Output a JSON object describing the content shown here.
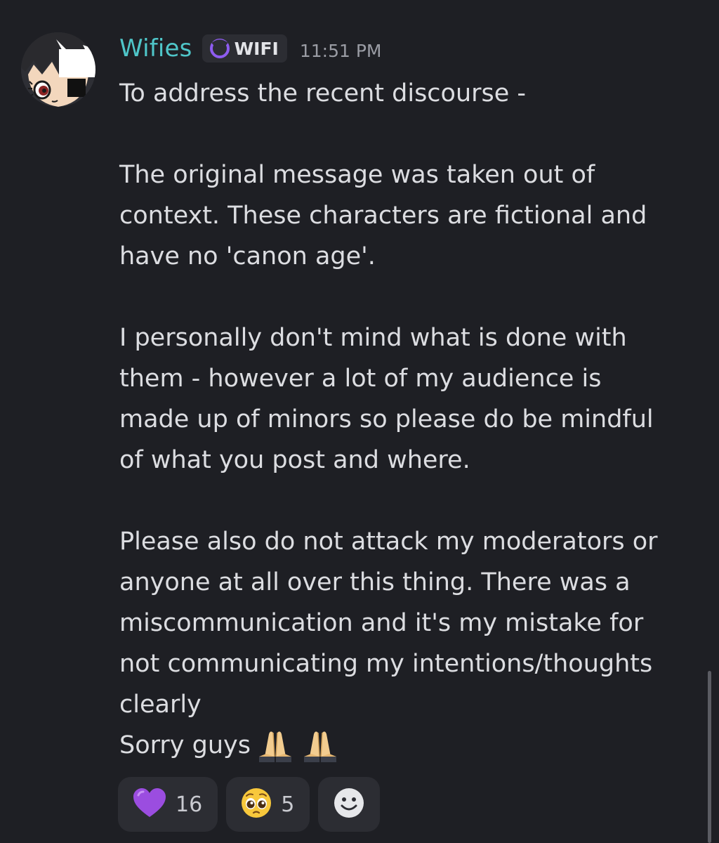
{
  "message": {
    "author": "Wifies",
    "tag": "WIFI",
    "timestamp": "11:51 PM",
    "paragraphs": [
      [
        "To address the recent discourse -"
      ],
      [
        "The original message was taken out of",
        "context. These characters are fictional and",
        "have no 'canon age'."
      ],
      [
        "I personally don't mind what is done with",
        "them - however a lot of my audience is",
        "made up of minors so please do be mindful",
        "of what you post and where."
      ],
      [
        "Please also do not attack my moderators or",
        "anyone at all over this thing. There was a",
        "miscommunication and it's my mistake for",
        "not communicating my intentions/thoughts",
        "clearly"
      ]
    ],
    "closing": "Sorry guys",
    "closing_emojis": [
      "folded-hands-emoji",
      "folded-hands-emoji"
    ]
  },
  "reactions": [
    {
      "emoji": "purple-heart-emoji",
      "count": "16"
    },
    {
      "emoji": "pleading-face-emoji",
      "count": "5"
    }
  ],
  "add_reaction_icon": "smiley-add-reaction-icon",
  "colors": {
    "background": "#1e1f24",
    "username": "#4fc6c9",
    "text": "#dcdde1",
    "timestamp": "#9a9ca4",
    "pill": "#2c2d33",
    "tag_icon": "#8e5cf0"
  }
}
